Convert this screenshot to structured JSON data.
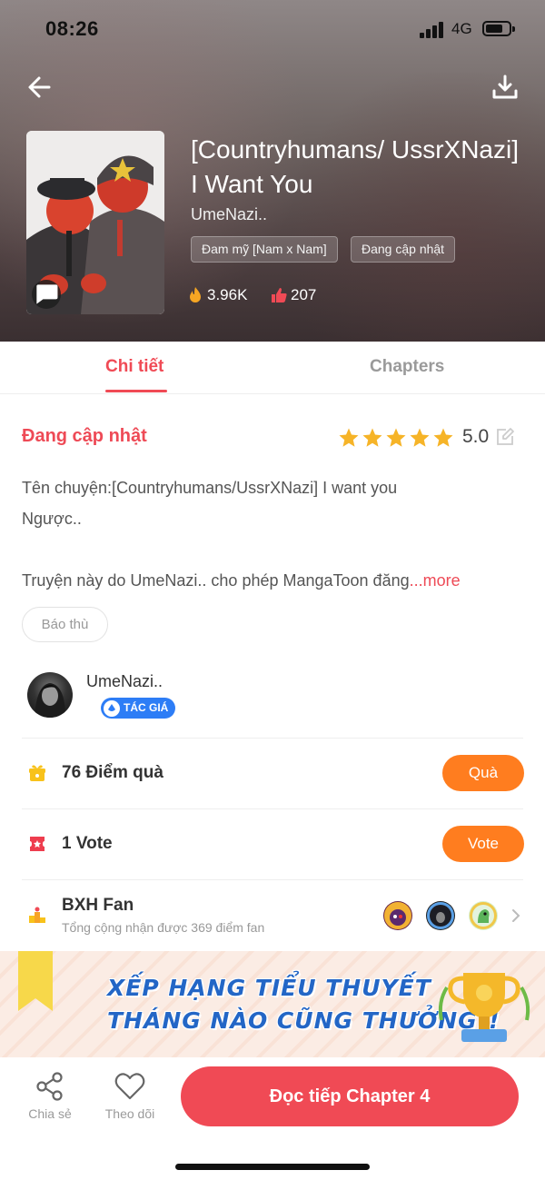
{
  "status_bar": {
    "time": "08:26",
    "network": "4G"
  },
  "book": {
    "title": "[Countryhumans/ UssrXNazi] I Want You",
    "author": "UmeNazi..",
    "tags": [
      "Đam mỹ [Nam x Nam]",
      "Đang cập nhật"
    ],
    "views": "3.96K",
    "likes": "207"
  },
  "tabs": [
    {
      "label": "Chi tiết",
      "active": true
    },
    {
      "label": "Chapters",
      "active": false
    }
  ],
  "details": {
    "status": "Đang cập nhật",
    "rating": "5.0",
    "stars": 5,
    "description_line1": "Tên chuyện:[Countryhumans/UssrXNazi] I want you",
    "description_line2": "Ngược..",
    "description_line3": "Truyện này do UmeNazi.. cho phép MangaToon đăng",
    "more_label": "...more",
    "report_label": "Báo thù"
  },
  "author_card": {
    "name": "UmeNazi..",
    "badge": "TÁC GIÁ"
  },
  "gifts": {
    "label": "76 Điểm quà",
    "button": "Quà"
  },
  "votes": {
    "label": "1 Vote",
    "button": "Vote"
  },
  "fans": {
    "title": "BXH Fan",
    "subtitle": "Tổng cộng nhận được 369 điểm fan"
  },
  "banner": {
    "line1": "XẾP HẠNG TIỂU THUYẾT",
    "line2": "THÁNG NÀO CŨNG THƯỞNG!!"
  },
  "bottom_bar": {
    "share": "Chia sẻ",
    "follow": "Theo dõi",
    "read": "Đọc tiếp Chapter 4"
  },
  "colors": {
    "accent": "#f04a55",
    "orange": "#ff7d1f",
    "star": "#f6b428",
    "badge_blue": "#2d7df6"
  },
  "icons": {
    "back": "arrow-left-icon",
    "download": "download-icon",
    "fire": "fire-icon",
    "thumb": "thumbs-up-icon",
    "gift": "gift-icon",
    "vote": "vote-ticket-icon",
    "fan": "podium-icon",
    "share": "share-icon",
    "heart": "heart-icon"
  }
}
